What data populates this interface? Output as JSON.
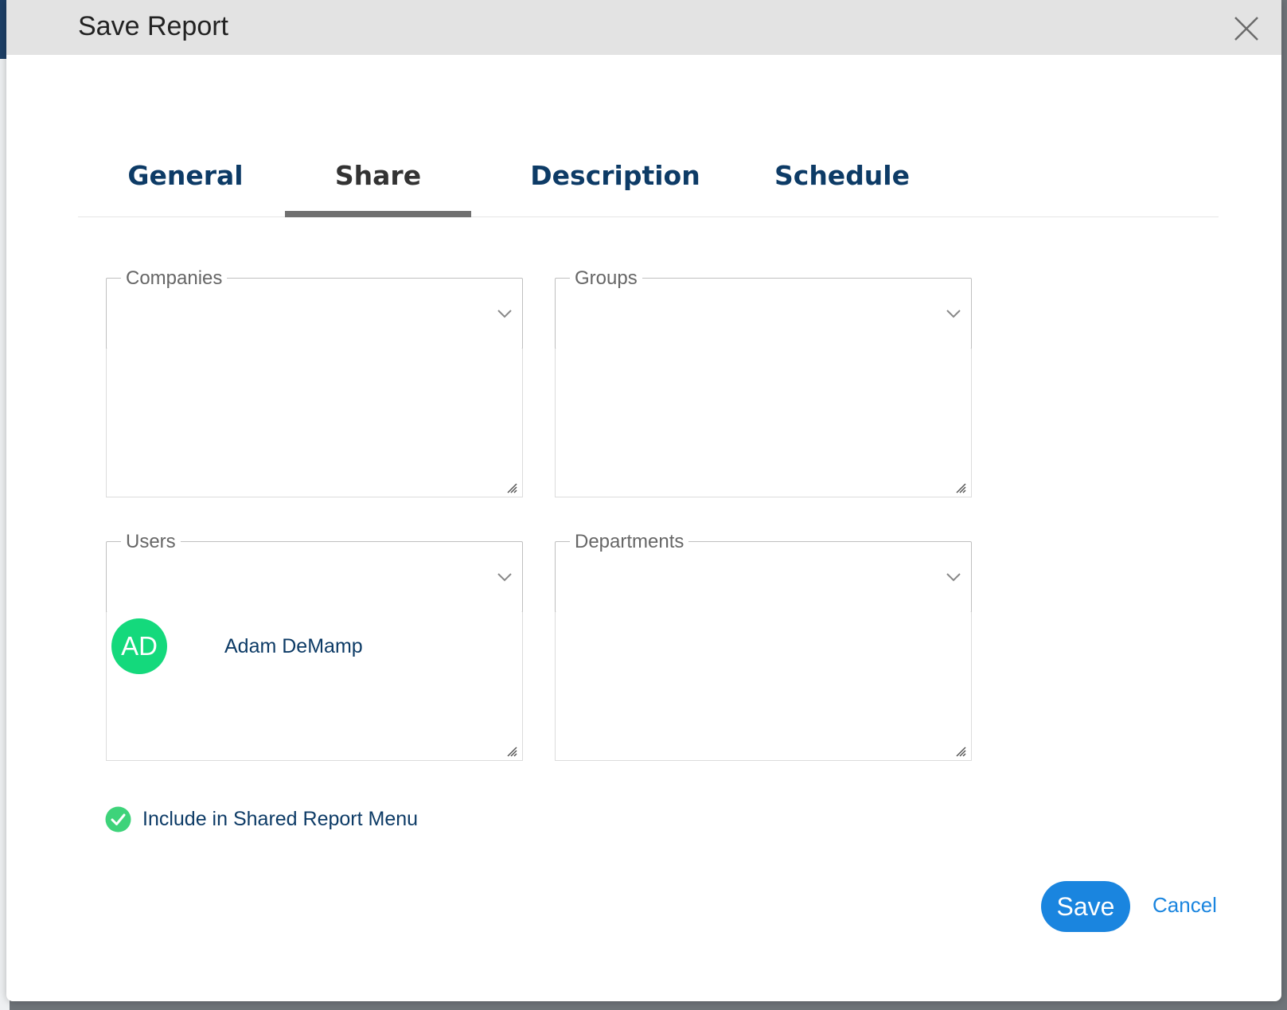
{
  "dialog": {
    "title": "Save Report",
    "close_icon": "close-icon"
  },
  "tabs": [
    {
      "label": "General",
      "active": false
    },
    {
      "label": "Share",
      "active": true
    },
    {
      "label": "Description",
      "active": false
    },
    {
      "label": "Schedule",
      "active": false
    }
  ],
  "share": {
    "companies": {
      "label": "Companies",
      "items": []
    },
    "groups": {
      "label": "Groups",
      "items": []
    },
    "users": {
      "label": "Users",
      "items": [
        {
          "initials": "AD",
          "name": "Adam DeMamp"
        }
      ]
    },
    "departments": {
      "label": "Departments",
      "items": []
    },
    "include_shared_menu": {
      "label": "Include in Shared Report Menu",
      "checked": true
    }
  },
  "footer": {
    "save_label": "Save",
    "cancel_label": "Cancel"
  },
  "colors": {
    "primary_blue": "#1a85df",
    "navy_text": "#0d3b66",
    "avatar_green": "#14d97c",
    "check_green": "#3ed37a",
    "header_bg": "#e3e3e3"
  }
}
